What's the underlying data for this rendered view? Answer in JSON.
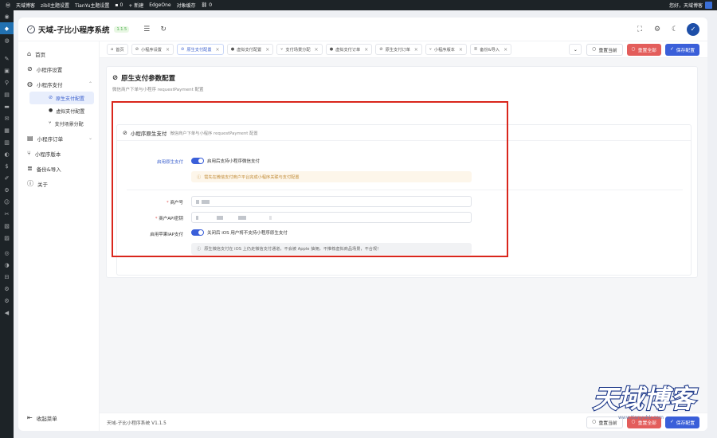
{
  "adminbar": {
    "site": "天域博客",
    "items": [
      "zibll主题设置",
      "TianYu主题设置",
      "0",
      "+ 新建",
      "EdgeOne",
      "对象缓存",
      "0"
    ],
    "greeting": "您好，天域博客"
  },
  "app": {
    "title": "天域-子比小程序系统",
    "version": "1.1.5"
  },
  "sidebar": {
    "items": [
      {
        "label": "首页",
        "icon": "home-icon"
      },
      {
        "label": "小程序设置",
        "icon": "settings-icon"
      },
      {
        "label": "小程序支付",
        "icon": "wallet-icon",
        "expanded": true
      },
      {
        "label": "小程序订单",
        "icon": "order-icon"
      },
      {
        "label": "小程序版本",
        "icon": "version-icon"
      },
      {
        "label": "备份&导入",
        "icon": "database-icon"
      },
      {
        "label": "关于",
        "icon": "info-icon"
      }
    ],
    "sub_items": [
      {
        "label": "原生支付配置",
        "active": true
      },
      {
        "label": "虚拟支付配置",
        "active": false
      },
      {
        "label": "支付场景分配",
        "active": false
      }
    ],
    "collapse_label": "收起菜单"
  },
  "tabs": [
    {
      "label": "首页",
      "closable": false,
      "active": false
    },
    {
      "label": "小程序设置",
      "closable": true,
      "active": false
    },
    {
      "label": "原生支付配置",
      "closable": true,
      "active": true
    },
    {
      "label": "虚拟支付配置",
      "closable": true,
      "active": false
    },
    {
      "label": "支付场景分配",
      "closable": true,
      "active": false
    },
    {
      "label": "虚拟支付订单",
      "closable": true,
      "active": false
    },
    {
      "label": "原生支付订单",
      "closable": true,
      "active": false
    },
    {
      "label": "小程序版本",
      "closable": true,
      "active": false
    },
    {
      "label": "备份&导入",
      "closable": true,
      "active": false
    }
  ],
  "actions": {
    "reset_current": "重置当前",
    "reset_all": "重置全部",
    "save": "保存配置"
  },
  "panel": {
    "title": "原生支付参数配置",
    "description": "微信商户下单与小程序 requestPayment 配置"
  },
  "card": {
    "title": "小程序原生支付",
    "description": "微信商户下单与小程序 requestPayment 配置",
    "enable_label": "启用原生支付",
    "enable_text": "启用后支持小程序微信支付",
    "enable_on": true,
    "warn_notice": "需先在微信支付商户平台完成小程序关联与支付配置",
    "merchant_id_label": "商户号",
    "merchant_key_label": "商户API密钥",
    "iap_label": "启用苹果IAP支付",
    "iap_text": "关闭后 iOS 用户将不支持小程序原生支付",
    "iap_on": true,
    "info_notice": "原生微信支付在 iOS 上仍走微信支付通道，不会被 Apple 抽佣，不推荐虚拟商品场景，不合规！"
  },
  "footer": {
    "copyright": "天域-子比小程序系统 V1.1.5"
  },
  "watermark": {
    "text": "天域博客",
    "url": "www.tianyubk.com"
  },
  "colors": {
    "accent": "#3a5fd9",
    "danger": "#e35d5b",
    "highlight_border": "#d9261c"
  }
}
